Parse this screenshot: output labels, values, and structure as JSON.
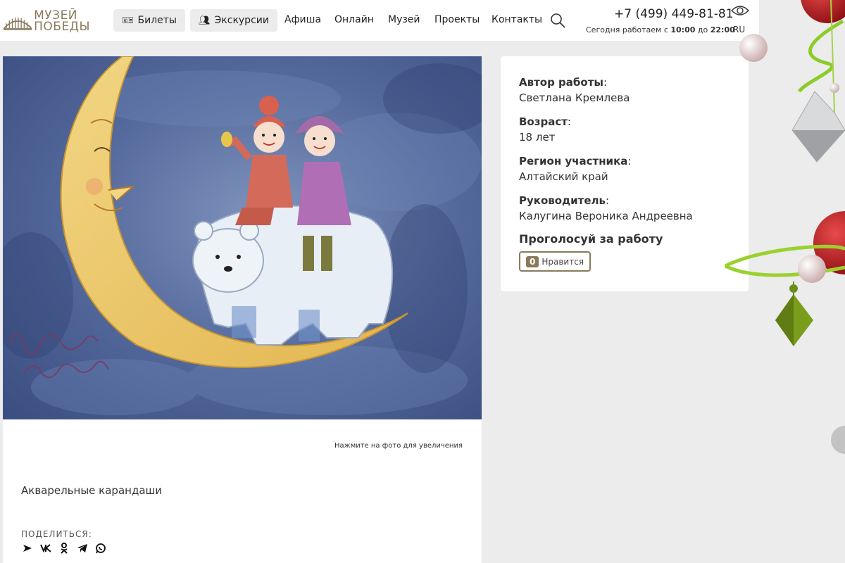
{
  "header": {
    "logo_text_line1": "МУЗЕЙ",
    "logo_text_line2": "ПОБЕДЫ",
    "tickets_label": "Билеты",
    "excursions_label": "Экскурсии",
    "nav": [
      "Афиша",
      "Онлайн",
      "Музей",
      "Проекты",
      "Контакты"
    ],
    "phone": "+7 (499) 449-81-81",
    "hours_prefix": "Сегодня работаем с",
    "hours_from": "10:00",
    "hours_mid": "до",
    "hours_to": "22:00",
    "lang": "RU"
  },
  "artwork": {
    "zoom_hint": "Нажмите на фото для увеличения",
    "technique": "Акварельные карандаши",
    "share_label": "ПОДЕЛИТЬСЯ:",
    "share_icons": [
      "arrow-icon",
      "vk-icon",
      "ok-icon",
      "telegram-icon",
      "whatsapp-icon"
    ]
  },
  "info": {
    "author_label": "Автор работы",
    "author_value": "Светлана Кремлева",
    "age_label": "Возраст",
    "age_value": "18 лет",
    "region_label": "Регион участника",
    "region_value": "Алтайский край",
    "mentor_label": "Руководитель",
    "mentor_value": "Калугина Вероника Андреевна",
    "vote_title": "Проголосуй за работу",
    "like_count": "0",
    "like_label": "Нравится"
  },
  "colors": {
    "accent": "#8a7a5c",
    "page_bg": "#ececec",
    "card_bg": "#ffffff"
  }
}
